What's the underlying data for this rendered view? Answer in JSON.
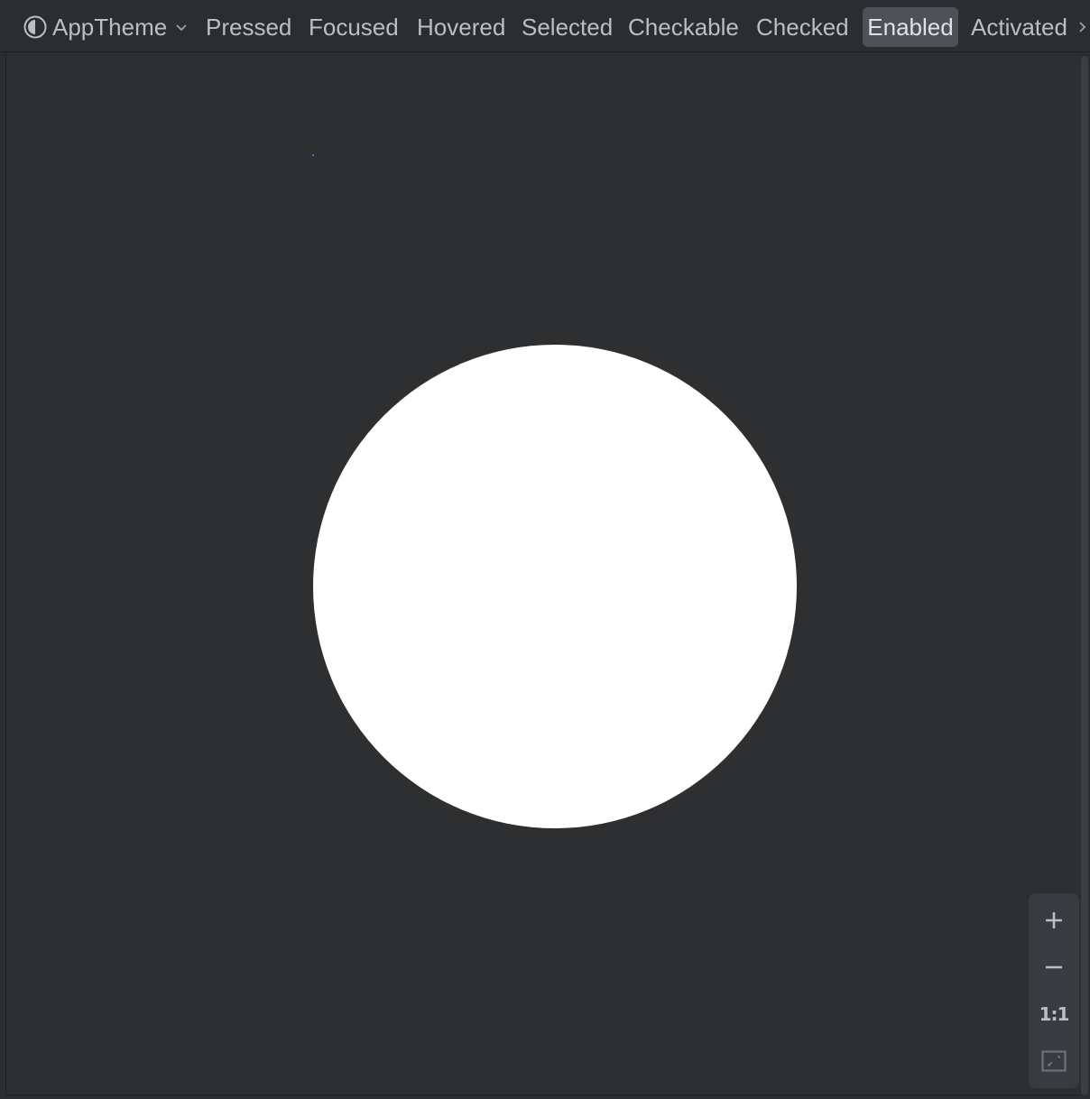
{
  "toolbar": {
    "theme": {
      "label": "AppTheme",
      "icon": "contrast-icon"
    },
    "states": [
      {
        "label": "Pressed",
        "selected": false
      },
      {
        "label": "Focused",
        "selected": false
      },
      {
        "label": "Hovered",
        "selected": false
      },
      {
        "label": "Selected",
        "selected": false
      },
      {
        "label": "Checkable",
        "selected": false
      },
      {
        "label": "Checked",
        "selected": false
      },
      {
        "label": "Enabled",
        "selected": true
      },
      {
        "label": "Activated",
        "selected": false
      }
    ],
    "more_icon": "chevron-right-icon"
  },
  "preview": {
    "shape": "oval",
    "fill_color": "#ffffff",
    "background_color": "#2e2f31"
  },
  "zoom_controls": {
    "zoom_in_icon": "plus-icon",
    "zoom_out_icon": "minus-icon",
    "actual_size_label": "1:1",
    "fit_screen_icon": "fit-screen-icon"
  },
  "colors": {
    "toolbar_text": "#bcbec4",
    "selected_bg": "#4e5157",
    "accent": "#3574f0"
  }
}
